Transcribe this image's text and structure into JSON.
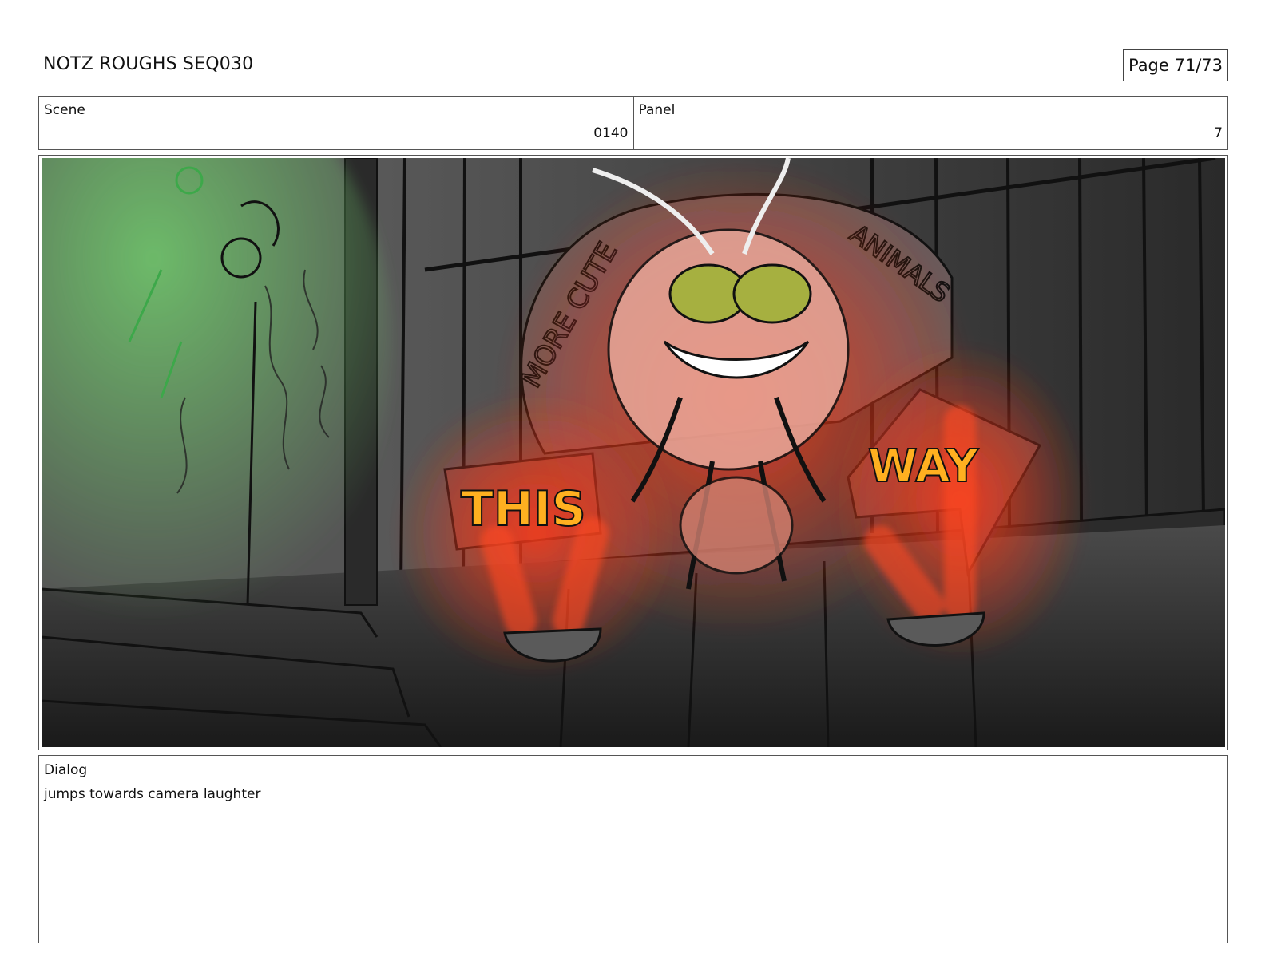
{
  "header": {
    "title": "NOTZ ROUGHS SEQ030",
    "page": "Page 71/73"
  },
  "scene": {
    "label": "Scene",
    "value": "0140"
  },
  "panel": {
    "label": "Panel",
    "value": "7"
  },
  "sketch": {
    "sign_words": [
      "THIS",
      "WAY"
    ],
    "arch_text": "MORE CUTE 3 ... ANIMALS",
    "colors": {
      "background": "#3a3a3a",
      "wall_dark": "#1e1e1e",
      "green_glow": "#5fb05a",
      "red_glow": "#ff3a1a",
      "sign_text": "#ffb020",
      "eyes": "#a6b040",
      "ink": "#111111"
    }
  },
  "dialog": {
    "label": "Dialog",
    "text": "jumps towards camera laughter"
  }
}
